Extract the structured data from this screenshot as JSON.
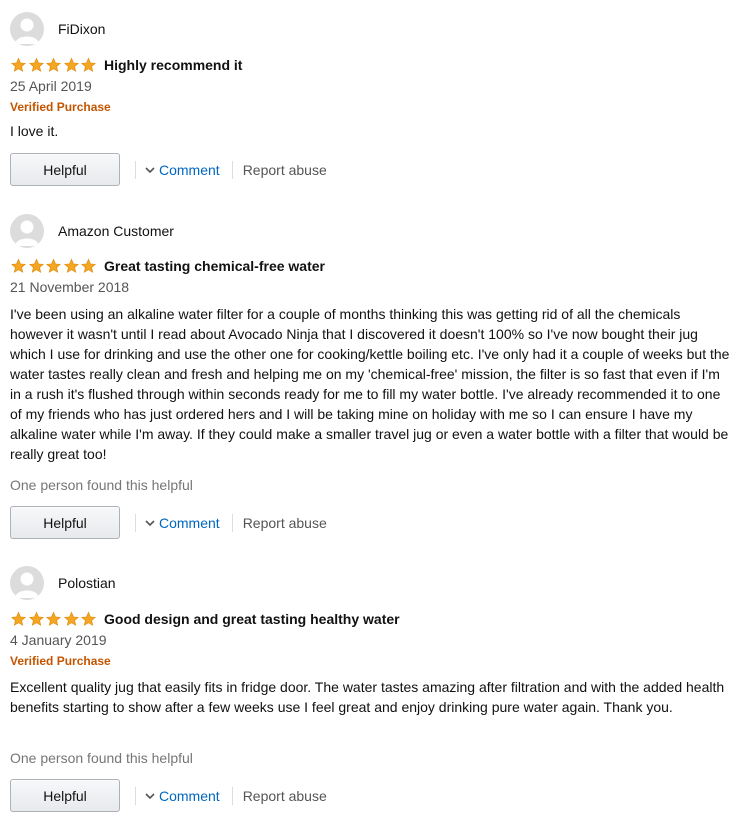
{
  "colors": {
    "star": "#f5a623",
    "verified": "#c45500",
    "link": "#0066c0"
  },
  "reviews": [
    {
      "username": "FiDixon",
      "rating": 5,
      "title": "Highly recommend it",
      "date": "25 April 2019",
      "verified": "Verified Purchase",
      "body": "I love it.",
      "helpful_count": "",
      "helpful_label": "Helpful",
      "comment_label": "Comment",
      "report_label": "Report abuse"
    },
    {
      "username": "Amazon Customer",
      "rating": 5,
      "title": "Great tasting chemical-free water",
      "date": "21 November 2018",
      "verified": "",
      "body": "I've been using an alkaline water filter for a couple of months thinking this was getting rid of all the chemicals however it wasn't until I read about Avocado Ninja that I discovered it doesn't 100% so I've now bought their jug which I use for drinking and use the other one for cooking/kettle boiling etc. I've only had it a couple of weeks but the water tastes really clean and fresh and helping me on my 'chemical-free' mission, the filter is so fast that even if I'm in a rush it's flushed through within seconds ready for me to fill my water bottle. I've already recommended it to one of my friends who has just ordered hers and I will be taking mine on holiday with me so I can ensure I have my alkaline water while I'm away. If they could make a smaller travel jug or even a water bottle with a filter that would be really great too!",
      "helpful_count": "One person found this helpful",
      "helpful_label": "Helpful",
      "comment_label": "Comment",
      "report_label": "Report abuse"
    },
    {
      "username": "Polostian",
      "rating": 5,
      "title": "Good design and great tasting healthy water",
      "date": "4 January 2019",
      "verified": "Verified Purchase",
      "body": "Excellent quality jug that easily fits in fridge door. The water tastes amazing after filtration and with the added health benefits starting to show after a few weeks use I feel great and enjoy drinking pure water again. Thank you.",
      "helpful_count": "One person found this helpful",
      "helpful_label": "Helpful",
      "comment_label": "Comment",
      "report_label": "Report abuse"
    }
  ]
}
